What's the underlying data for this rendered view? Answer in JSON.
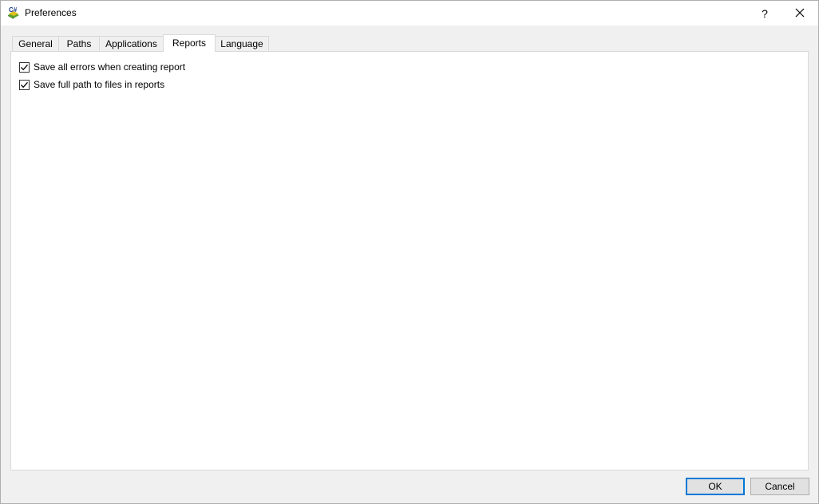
{
  "window": {
    "title": "Preferences",
    "help_label": "?",
    "close_label": "✕"
  },
  "tabs": [
    {
      "label": "General",
      "active": false
    },
    {
      "label": "Paths",
      "active": false
    },
    {
      "label": "Applications",
      "active": false
    },
    {
      "label": "Reports",
      "active": true
    },
    {
      "label": "Language",
      "active": false
    }
  ],
  "reports": {
    "options": [
      {
        "label": "Save all errors when creating report",
        "checked": true
      },
      {
        "label": "Save full path to files in reports",
        "checked": true
      }
    ]
  },
  "buttons": {
    "ok_label": "OK",
    "cancel_label": "Cancel"
  },
  "colors": {
    "accent": "#0078d7",
    "panel_bg": "#ffffff",
    "window_bg": "#f0f0f0"
  }
}
